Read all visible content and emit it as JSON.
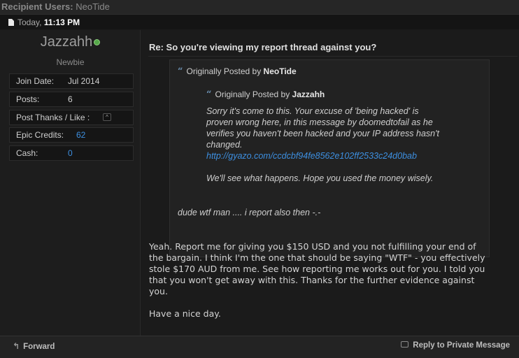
{
  "recipients": {
    "label": "Recipient Users:",
    "value": "NeoTide"
  },
  "post_date": {
    "day": "Today,",
    "time": "11:13 PM"
  },
  "user": {
    "name": "Jazzahh",
    "title": "Newbie",
    "online_status_color": "#56a84a",
    "info": {
      "join_date_label": "Join Date:",
      "join_date_value": "Jul 2014",
      "posts_label": "Posts:",
      "posts_value": "6",
      "thanks_label": "Post Thanks / Like :",
      "thanks_toggle": "^",
      "credits_label": "Epic Credits:",
      "credits_value": "62",
      "cash_label": "Cash:",
      "cash_value": "0"
    }
  },
  "post": {
    "title": "Re: So you're viewing my report thread against you?",
    "quote": {
      "prefix": "Originally Posted by",
      "author": "NeoTide",
      "nested": {
        "prefix": "Originally Posted by",
        "author": "Jazzahh",
        "text_lines": [
          "Sorry it's come to this. Your excuse of 'being hacked' is",
          "proven wrong here, in this message by doomedtofail as he",
          "verifies you haven't been hacked and your IP address hasn't",
          "changed."
        ],
        "link": "http://gyazo.com/ccdcbf94fe8562e102ff2533c24d0bab",
        "closing": "We'll see what happens. Hope you used the money wisely."
      },
      "reply": "dude wtf man .... i report also then -.-"
    },
    "message_lines": [
      "Yeah. Report me for giving you $150 USD and you not fulfilling your end of",
      "the bargain. I think I'm the one that should be saying \"WTF\" - you effectively",
      "stole $170 AUD from me. See how reporting me works out for you. I told you",
      "that you won't get away with this. Thanks for the further evidence against",
      "you.",
      "",
      "Have a nice day."
    ]
  },
  "footer": {
    "forward_label": "Forward",
    "reply_label": "Reply to Private Message"
  },
  "colors": {
    "link": "#3d8fe0",
    "background": "#1b1b1b",
    "quote_background": "#222222"
  }
}
